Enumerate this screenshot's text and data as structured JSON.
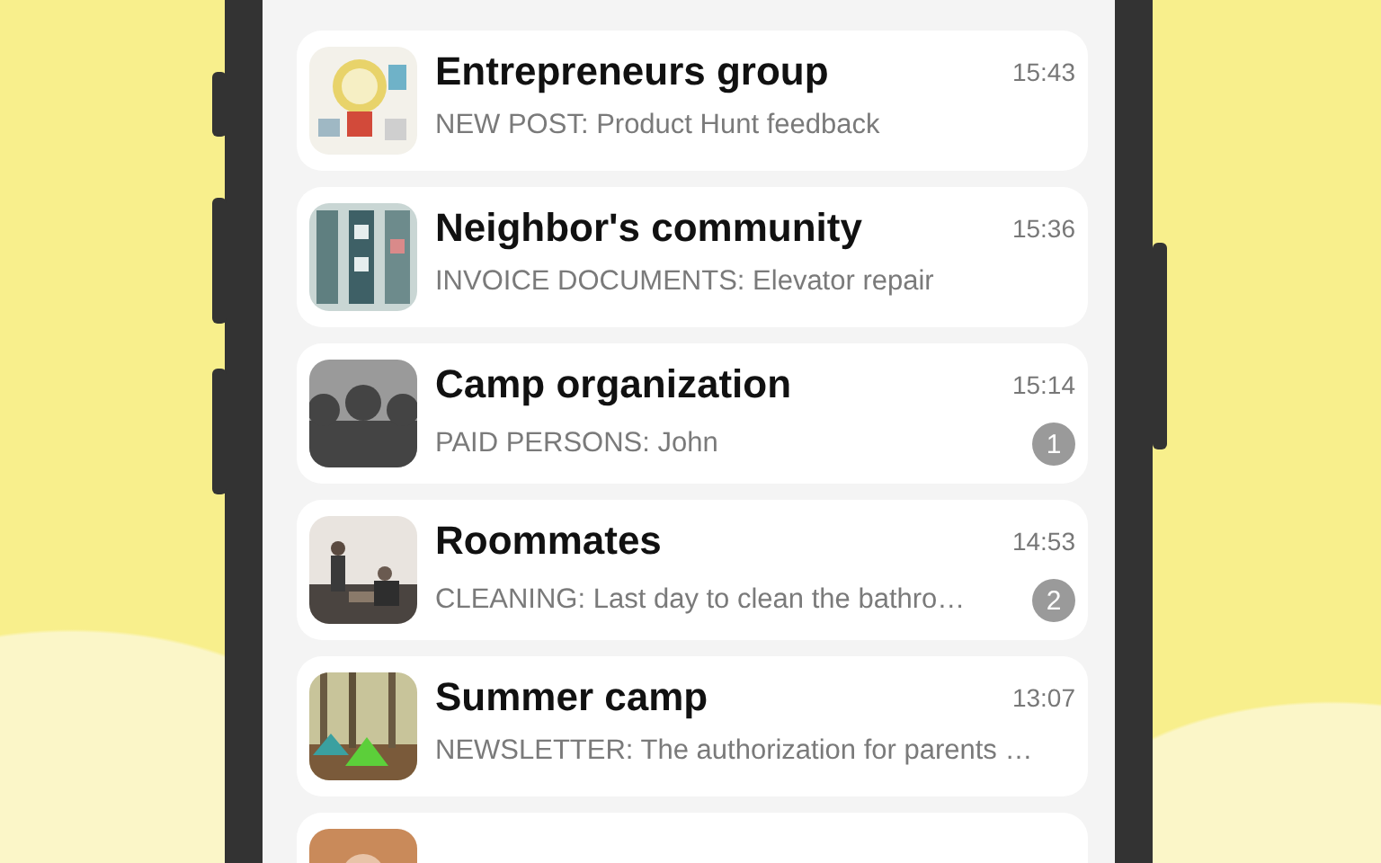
{
  "chats": [
    {
      "title": "Entrepreneurs group",
      "time": "15:43",
      "preview": "NEW POST: Product Hunt feedback",
      "avatar": {
        "kind": "picture"
      }
    },
    {
      "title": "Neighbor's community",
      "time": "15:36",
      "preview": "INVOICE DOCUMENTS: Elevator repair",
      "avatar": {
        "kind": "picture"
      }
    },
    {
      "title": "Camp organization",
      "time": "15:14",
      "preview": "PAID PERSONS: John",
      "unread": "1",
      "avatar": {
        "kind": "group"
      }
    },
    {
      "title": "Roommates",
      "time": "14:53",
      "preview": "CLEANING: Last day to clean the bathro…",
      "unread": "2",
      "avatar": {
        "kind": "picture"
      }
    },
    {
      "title": "Summer camp",
      "time": "13:07",
      "preview": "NEWSLETTER: The authorization for parents …",
      "avatar": {
        "kind": "picture"
      }
    },
    {
      "avatar": {
        "kind": "picture"
      }
    }
  ]
}
